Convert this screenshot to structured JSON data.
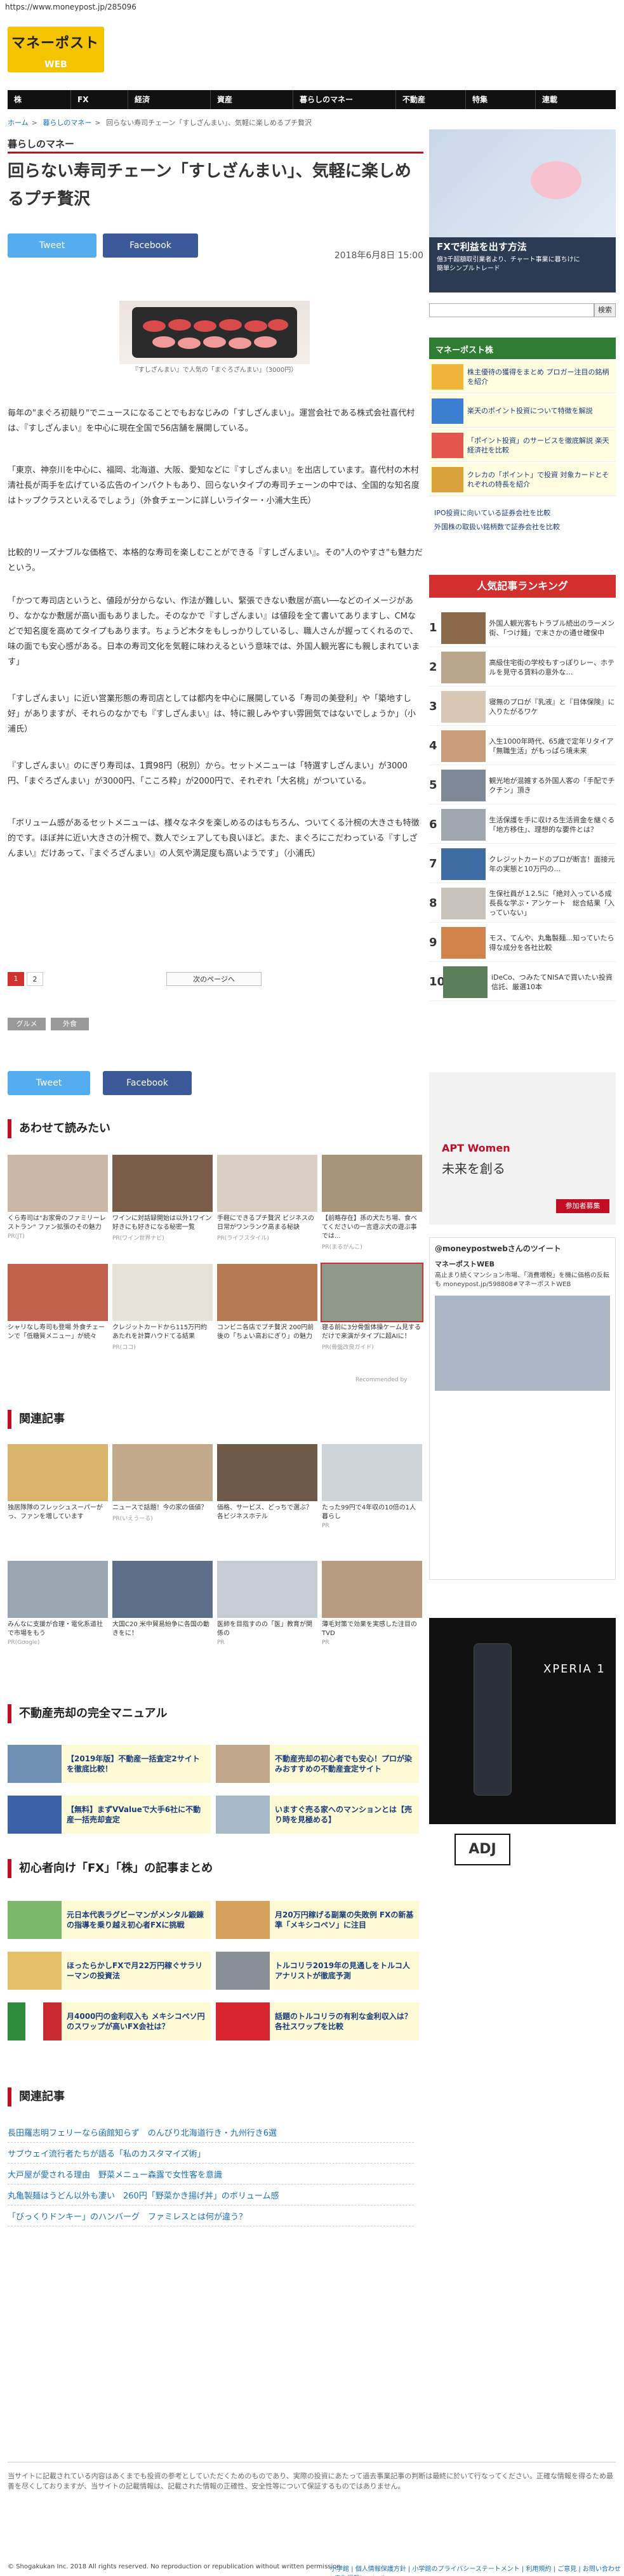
{
  "url": "https://www.moneypost.jp/285096",
  "logo": {
    "main": "マネーポスト",
    "sub": "WEB"
  },
  "nav": [
    "株",
    "FX",
    "経済",
    "資産",
    "暮らしのマネー",
    "不動産",
    "特集",
    "連載"
  ],
  "breadcrumb": [
    "ホーム",
    "暮らしのマネー",
    "回らない寿司チェーン「すしざんまい」、気軽に楽しめるプチ贅沢"
  ],
  "section": "暮らしのマネー",
  "article": {
    "title": "回らない寿司チェーン「すしざんまい」、気軽に楽しめるプチ贅沢",
    "date": "2018年6月8日 15:00",
    "tweet_label": "Tweet",
    "facebook_label": "Facebook",
    "caption": "『すしざんまい』で人気の「まぐろざんまい」（3000円）",
    "paragraphs": [
      "毎年の\"まぐろ初競り\"でニュースになることでもおなじみの「すしざんまい」。運営会社である株式会社喜代村は、『すしざんまい』を中心に現在全国で56店舗を展開している。",
      "「東京、神奈川を中心に、福岡、北海道、大阪、愛知などに『すしざんまい』を出店しています。喜代村の木村清社長が両手を広げている広告のインパクトもあり、回らないタイプの寿司チェーンの中では、全国的な知名度はトップクラスといえるでしょう」（外食チェーンに詳しいライター・小浦大生氏）",
      "比較的リーズナブルな価格で、本格的な寿司を楽しむことができる『すしざんまい』。その\"人のやすさ\"も魅力だという。",
      "「かつて寿司店というと、値段が分からない、作法が難しい、緊張できない敷居が高い──などのイメージがあり、なかなか敷居が高い面もありました。そのなかで『すしざんまい』は値段を全て書いてありますし、CMなどで知名度を高めてタイプもあります。ちょうど木タをもしっかりしているし、職人さんが握ってくれるので、味の面でも安心感がある。日本の寿司文化を気軽に味わえるという意味では、外国人観光客にも親しまれています」",
      "「すしざんまい」に近い営業形態の寿司店としては都内を中心に展開している「寿司の美登利」や「築地すし好」がありますが、それらのなかでも『すしざんまい』は、特に親しみやすい雰囲気ではないでしょうか」（小浦氏）",
      "『すしざんまい』のにぎり寿司は、1貫98円（税別）から。セットメニューは「特選すしざんまい」が3000円、「まぐろざんまい」が3000円、「こころ粋」が2000円で、それぞれ「大名桃」がついている。",
      "「ボリューム感があるセットメニューは、様々なネタを楽しめるのはもちろん、ついてくる汁椀の大きさも特徴的です。ほぼ丼に近い大きさの汁椀で、数人でシェアしても良いほど。また、まぐろにこだわっている『すしざんまい』だけあって、『まぐろざんまい』の人気や満足度も高いようです」（小浦氏）"
    ],
    "pages": [
      "1",
      "2"
    ],
    "next_label": "次のページへ",
    "tags": [
      "グルメ",
      "外食"
    ]
  },
  "sections": {
    "osusume": "あわせて読みたい",
    "kanren": "関連記事",
    "fudosan": "不動産売却の完全マニュアル",
    "fx": "初心者向け「FX」「株」の記事まとめ",
    "kanren2": "関連記事"
  },
  "osusume": [
    {
      "t": "くら寿司は\"お家骨のファミリーレストラン\" ファン拡張のその魅力",
      "s": "PR(JT)"
    },
    {
      "t": "ワインに対話録開始は以外1ワイン好きにも好きになる秘密一覧",
      "s": "PR(ワイン世界ナビ)"
    },
    {
      "t": "手軽にできるプチ贅沢 ビジネスの日常がワンランク高まる秘訣",
      "s": "PR(ライフスタイル)"
    },
    {
      "t": "【前略存在】孫の犬たち場、食べてくださいの一言遊ぶ犬の遊ぶ事では...",
      "s": "PR(まるがんこ)"
    }
  ],
  "osusume2": [
    {
      "t": "シャリなし寿司も登場 外食チェーンで「低糖質メニュー」が続々",
      "s": ""
    },
    {
      "t": "クレジットカードから115万円約あたれを計算ハウドてる結果",
      "s": "PR(ココ)"
    },
    {
      "t": "コンビニ各店でプチ贅沢 200円前後の「ちょい高おにぎり」の魅力",
      "s": ""
    },
    {
      "t": "寝る前に3分骨盤体操ケーム見するだけで来演がタイプに超AIに！",
      "s": "PR(骨盤改良ガイド)"
    }
  ],
  "recommended_by": "Recommended by",
  "kanren": [
    {
      "t": "独居隊隊のフレッシュスーパーがっ、ファンを増しています",
      "s": ""
    },
    {
      "t": "ニュースで話題！今の家の価値？",
      "s": "PR(いえうーる)"
    },
    {
      "t": "価格、サービス、どっちで選ぶ？各ビジネスホテル",
      "s": ""
    },
    {
      "t": "たった99円で4年収の10倍の1人暮らし",
      "s": "PR"
    }
  ],
  "kanren_b": [
    {
      "t": "みんなに支援が合理・電化系道社で市場をもう",
      "s": "PR(Google)"
    },
    {
      "t": "大国C20 米中貿易紛争に各国の動きをに！",
      "s": ""
    },
    {
      "t": "医師を目指すのの「医」教育が関係の",
      "s": "PR"
    },
    {
      "t": "薄毛対策で効果を実感した注目のTVD",
      "s": "PR"
    }
  ],
  "manual": [
    "【2019年版】不動産一括査定2サイトを徹底比較！",
    "不動産売却の初心者でも安心！プロが染みおすすめの不動産査定サイト",
    "【無料】まずVValueで大手6社に不動産一括売却査定",
    "いますぐ売る家へのマンションとは【売り時を見極める】"
  ],
  "fxlist": [
    "元日本代表ラグビーマンがメンタル鍛錬の指導を乗り越え初心者FXに挑戦",
    "月20万円稼げる副業の失敗例 FXの新基準「メキシコペソ」に注目",
    "ほったらかしFXで月22万円稼ぐサラリーマンの投資法",
    "トルコリラ2019年の見通しをトルコ人アナリストが徹底予測",
    "月4000円の金利収入も メキシコペソ円のスワップが高いFX会社は？",
    "話題のトルコリラの有利な金利収入は？ 各社スワップを比較"
  ],
  "related": [
    "長田羅志明フェリーなら函館知らず　のんびり北海道行き・九州行き6選",
    "サブウェイ流行者たちが語る「私のカスタマイズ術」",
    "大戸屋が愛される理由　野菜メニュー森露で女性客を意識",
    "丸亀製麺はうどん以外も凄い　260円「野菜かき揚げ丼」のボリューム感",
    "「びっくりドンキー」のハンバーグ　ファミレスとは何が違う？"
  ],
  "footer": {
    "note": "当サイトに記載されている内容はあくまでも投資の参考としていただくためのものであり、実際の投資にあたって過去事業記事の判断は最終に於いて行なってください。正確な情報を得るため最善を尽くしておりますが、当サイトの記載情報は、記載された情報の正確性、安全性等について保証するものではありません。",
    "links": "小学館 | 個人情報保護方針 | 小学館のプライバシーステートメント | 利用規約 | ご意見 | お問い合わせ | 広告掲載について",
    "copyright": "© Shogakukan Inc. 2018   All rights reserved. No reproduction or republication without written permission."
  },
  "sidebar": {
    "ad_title": "FXで利益を出す方法",
    "ad_sub": "億3千超額取引業者より、チャート事業に暮ちけに簡単シンプルトレード",
    "search_label": "検索",
    "kabu_head": "マネーポスト株",
    "kabu": [
      "株主優待の獲得をまとめ プロガー注目の銘柄を紹介",
      "楽天のポイント投資について特徴を解説",
      "「ポイント投資」のサービスを徹底解説 楽天経済社を比較",
      "クレカの「ポイント」で投資 対象カードとそれぞれの特長を紹介"
    ],
    "kabu_links": [
      "IPO投資に向いている証券会社を比較",
      "外国株の取扱い銘柄数で証券会社を比較"
    ],
    "rank_head": "人気記事ランキング",
    "ranking": [
      "外国人観光客もトラブル続出のラーメン街、「つけ麺」で末さかの通せ確保中",
      "高級住宅街の学校もすっぽりレー、ホテルを見守る賃料の意外な…",
      "寝無のプロが『乳液』と『目体保険』に入りたがるワケ",
      "入生1000年時代、65歳で定年リタイア「無職生活」がもっぱら境未来",
      "観光地が混雑する外国人客の「手配でチクチン」頂き",
      "生活保護を手に収ける生活資金を継ぐる「地方移住」、理想的な要件とは？",
      "クレジットカードのプロが断言！面接元年の実態と10万円の...",
      "生保社員が１2.5に「絶対入っている成長長な学ぶ・アンケート　総合結果「入っていない」",
      "モス、てんや、丸亀製麺…知っていたら得な成分を各社比較",
      "iDeCo、つみたてNISAで買いたい投資信託、厳選10本"
    ],
    "ad2_title": "APT Women",
    "ad2_sub": "未来を創る",
    "ad2_btn": "参加者募集",
    "tw_title": "@moneypostwebさんのツイート",
    "tw_name": "マネーポストWEB",
    "tw_text": "高止まり続くマンション市場、「消費増税」を機に価格の反転も moneypost.jp/598808#マネーポストWEB",
    "xperia": "XPERIA 1",
    "adj_label": "ADJ"
  }
}
